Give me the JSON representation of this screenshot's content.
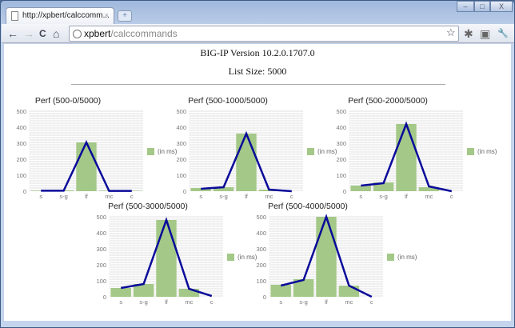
{
  "browser": {
    "tab_title": "http://xpbert/calccomm...",
    "tab_close": "×",
    "new_tab": "+",
    "url_host": "xpbert",
    "url_path": "/calccommands",
    "buttons": {
      "back": "←",
      "forward": "→",
      "reload": "C",
      "home": "⌂",
      "star": "☆",
      "ext1": "✱",
      "ext2": "▣",
      "wrench": "🔧",
      "minimize": "–",
      "maximize": "□",
      "close": "X"
    }
  },
  "page": {
    "version": "BIG-IP Version 10.2.0.1707.0",
    "list_size": "List Size: 5000"
  },
  "colors": {
    "bar": "#a4c887",
    "line": "#0a0a9a"
  },
  "chart_data": [
    {
      "type": "bar+line",
      "title": "Perf (500-0/5000)",
      "categories": [
        "s",
        "s-g",
        "lf",
        "mc",
        "c"
      ],
      "bars": [
        3,
        5,
        305,
        3,
        2
      ],
      "line": [
        3,
        3,
        305,
        2,
        2
      ],
      "legend": "(in ms)",
      "ylim": [
        0,
        500
      ],
      "yticks": [
        "0",
        "100",
        "200",
        "300",
        "400",
        "500"
      ]
    },
    {
      "type": "bar+line",
      "title": "Perf (500-1000/5000)",
      "categories": [
        "s",
        "s-g",
        "lf",
        "mc",
        "c"
      ],
      "bars": [
        20,
        25,
        360,
        10,
        0
      ],
      "line": [
        15,
        25,
        360,
        10,
        0
      ],
      "legend": "(in ms)",
      "ylim": [
        0,
        500
      ],
      "yticks": [
        "0",
        "100",
        "200",
        "300",
        "400",
        "500"
      ]
    },
    {
      "type": "bar+line",
      "title": "Perf (500-2000/5000)",
      "categories": [
        "s",
        "s-g",
        "lf",
        "mc",
        "c"
      ],
      "bars": [
        35,
        55,
        420,
        25,
        0
      ],
      "line": [
        35,
        50,
        420,
        30,
        0
      ],
      "legend": "(in ms)",
      "ylim": [
        0,
        500
      ],
      "yticks": [
        "0",
        "100",
        "200",
        "300",
        "400",
        "500"
      ]
    },
    {
      "type": "bar+line",
      "title": "Perf (500-3000/5000)",
      "categories": [
        "s",
        "s-g",
        "lf",
        "mc",
        "c"
      ],
      "bars": [
        55,
        80,
        480,
        50,
        0
      ],
      "line": [
        55,
        80,
        480,
        50,
        5
      ],
      "legend": "(in ms)",
      "ylim": [
        0,
        500
      ],
      "yticks": [
        "0",
        "100",
        "200",
        "300",
        "400",
        "500"
      ]
    },
    {
      "type": "bar+line",
      "title": "Perf (500-4000/5000)",
      "categories": [
        "s",
        "s-g",
        "lf",
        "mc",
        "c"
      ],
      "bars": [
        75,
        110,
        500,
        70,
        0
      ],
      "line": [
        70,
        105,
        500,
        70,
        0
      ],
      "legend": "(in ms)",
      "ylim": [
        0,
        500
      ],
      "yticks": [
        "0",
        "100",
        "200",
        "300",
        "400",
        "500"
      ]
    }
  ]
}
